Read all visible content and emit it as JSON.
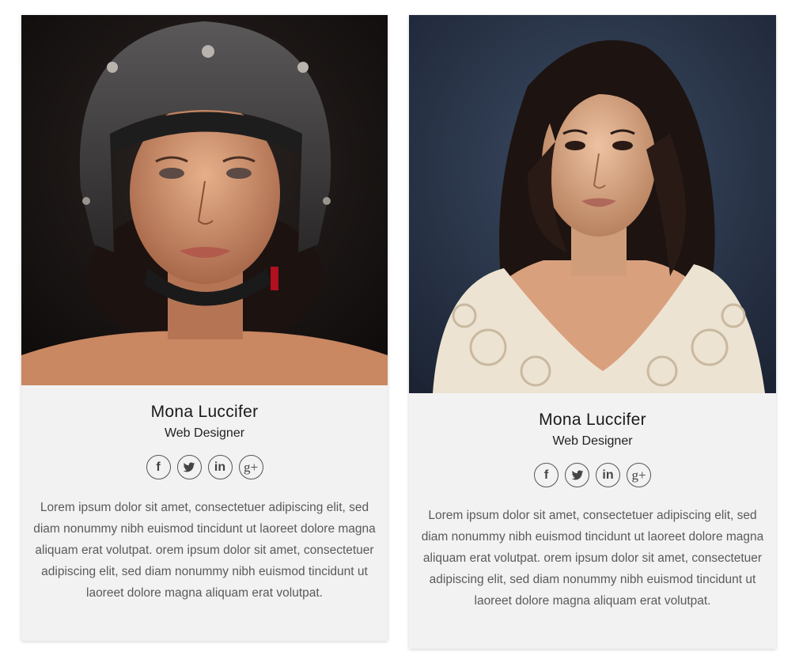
{
  "cards": [
    {
      "name": "Mona Luccifer",
      "role": "Web Designer",
      "photo_icon": "portrait-helmet-photo",
      "socials": [
        {
          "icon": "facebook-icon",
          "glyph": "f"
        },
        {
          "icon": "twitter-icon",
          "glyph": "🐦"
        },
        {
          "icon": "linkedin-icon",
          "glyph": "in"
        },
        {
          "icon": "google-plus-icon",
          "glyph": "g+"
        }
      ],
      "bio": "Lorem ipsum dolor sit amet, consectetuer adipiscing elit, sed diam nonummy nibh euismod tincidunt ut laoreet dolore magna aliquam erat volutpat. orem ipsum dolor sit amet, consectetuer adipiscing elit, sed diam nonummy nibh euismod tincidunt ut laoreet dolore magna aliquam erat volutpat."
    },
    {
      "name": "Mona Luccifer",
      "role": "Web Designer",
      "photo_icon": "portrait-lace-top-photo",
      "socials": [
        {
          "icon": "facebook-icon",
          "glyph": "f"
        },
        {
          "icon": "twitter-icon",
          "glyph": "🐦"
        },
        {
          "icon": "linkedin-icon",
          "glyph": "in"
        },
        {
          "icon": "google-plus-icon",
          "glyph": "g+"
        }
      ],
      "bio": "Lorem ipsum dolor sit amet, consectetuer adipiscing elit, sed diam nonummy nibh euismod tincidunt ut laoreet dolore magna aliquam erat volutpat. orem ipsum dolor sit amet, consectetuer adipiscing elit, sed diam nonummy nibh euismod tincidunt ut laoreet dolore magna aliquam erat volutpat."
    }
  ],
  "colors": {
    "card_bg": "#f2f2f2",
    "text_dark": "#1a1a1a",
    "text_body": "#5a5a5a",
    "icon_border": "#555555"
  }
}
